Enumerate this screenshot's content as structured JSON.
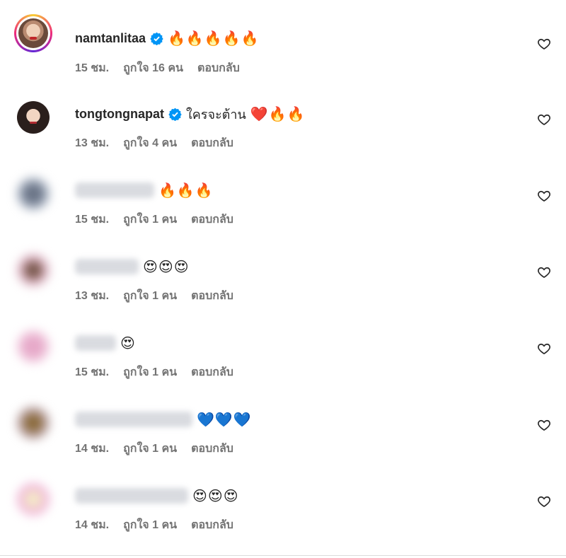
{
  "comments": [
    {
      "username": "namtanlitaa",
      "verified": true,
      "text": "",
      "emoji": "🔥🔥🔥🔥🔥",
      "time": "15 ชม.",
      "likes": "ถูกใจ 16 คน",
      "reply": "ตอบกลับ"
    },
    {
      "username": "tongtongnapat",
      "verified": true,
      "text": "ใครจะต้าน",
      "emoji": "❤️🔥🔥",
      "time": "13 ชม.",
      "likes": "ถูกใจ 4 คน",
      "reply": "ตอบกลับ"
    },
    {
      "username": "",
      "verified": false,
      "text": "",
      "emoji": "🔥🔥🔥",
      "time": "15 ชม.",
      "likes": "ถูกใจ 1 คน",
      "reply": "ตอบกลับ"
    },
    {
      "username": "",
      "verified": false,
      "text": "",
      "emoji": "😍😍😍",
      "time": "13 ชม.",
      "likes": "ถูกใจ 1 คน",
      "reply": "ตอบกลับ"
    },
    {
      "username": "",
      "verified": false,
      "text": "",
      "emoji": "😍",
      "time": "15 ชม.",
      "likes": "ถูกใจ 1 คน",
      "reply": "ตอบกลับ"
    },
    {
      "username": "",
      "verified": false,
      "text": "",
      "emoji": "💙💙💙",
      "time": "14 ชม.",
      "likes": "ถูกใจ 1 คน",
      "reply": "ตอบกลับ"
    },
    {
      "username": "",
      "verified": false,
      "text": "",
      "emoji": "😍😍😍",
      "time": "14 ชม.",
      "likes": "ถูกใจ 1 คน",
      "reply": "ตอบกลับ"
    }
  ],
  "icons": {
    "like": "heart-outline-icon",
    "verified": "verified-badge-icon"
  },
  "colors": {
    "verified": "#0095f6",
    "meta": "#737373",
    "text": "#262626"
  }
}
